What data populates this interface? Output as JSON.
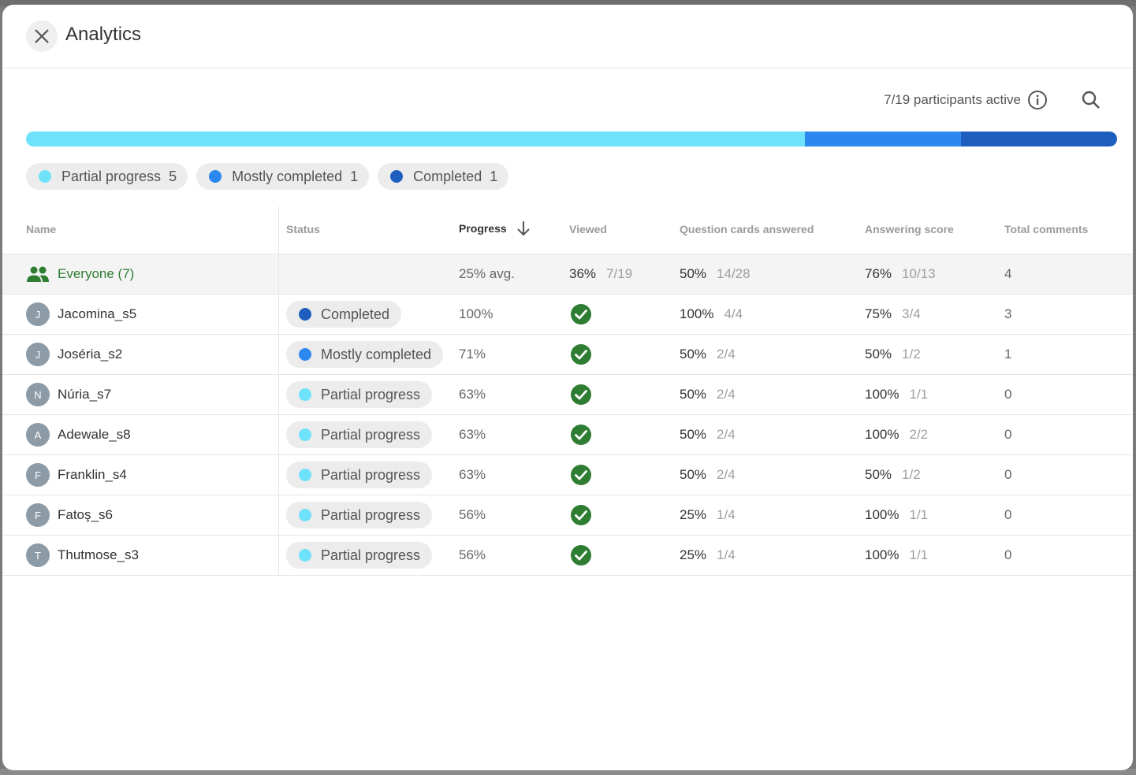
{
  "dialog": {
    "title": "Analytics",
    "close_icon": "close-icon"
  },
  "summary": {
    "active_text": "7/19 participants active",
    "info_icon": "info-icon",
    "search_icon": "search-icon"
  },
  "progress_bar": {
    "partial_fraction": 0.714,
    "mostly_fraction": 0.143,
    "completed_fraction": 0.143
  },
  "legend": [
    {
      "label": "Partial progress",
      "count": "5",
      "color": "#6fe2fb"
    },
    {
      "label": "Mostly completed",
      "count": "1",
      "color": "#2a88ee"
    },
    {
      "label": "Completed",
      "count": "1",
      "color": "#1e5ebe"
    }
  ],
  "columns": {
    "name": "Name",
    "status": "Status",
    "progress": "Progress",
    "viewed": "Viewed",
    "question_cards": "Question cards answered",
    "answering_score": "Answering score",
    "total_comments": "Total comments",
    "sort_icon": "arrow-down-icon"
  },
  "everyone": {
    "label": "Everyone (7)",
    "icon": "group-icon",
    "progress": "25% avg.",
    "viewed_pct": "36%",
    "viewed_frac": "7/19",
    "cards_pct": "50%",
    "cards_frac": "14/28",
    "score_pct": "76%",
    "score_frac": "10/13",
    "comments": "4"
  },
  "rows": [
    {
      "initial": "J",
      "name": "Jacomina_s5",
      "status": "Completed",
      "status_color": "#1e5ebe",
      "progress": "100%",
      "cards_pct": "100%",
      "cards_frac": "4/4",
      "score_pct": "75%",
      "score_frac": "3/4",
      "comments": "3"
    },
    {
      "initial": "J",
      "name": "Joséria_s2",
      "status": "Mostly completed",
      "status_color": "#2a88ee",
      "progress": "71%",
      "cards_pct": "50%",
      "cards_frac": "2/4",
      "score_pct": "50%",
      "score_frac": "1/2",
      "comments": "1"
    },
    {
      "initial": "N",
      "name": "Núria_s7",
      "status": "Partial progress",
      "status_color": "#6fe2fb",
      "progress": "63%",
      "cards_pct": "50%",
      "cards_frac": "2/4",
      "score_pct": "100%",
      "score_frac": "1/1",
      "comments": "0"
    },
    {
      "initial": "A",
      "name": "Adewale_s8",
      "status": "Partial progress",
      "status_color": "#6fe2fb",
      "progress": "63%",
      "cards_pct": "50%",
      "cards_frac": "2/4",
      "score_pct": "100%",
      "score_frac": "2/2",
      "comments": "0"
    },
    {
      "initial": "F",
      "name": "Franklin_s4",
      "status": "Partial progress",
      "status_color": "#6fe2fb",
      "progress": "63%",
      "cards_pct": "50%",
      "cards_frac": "2/4",
      "score_pct": "50%",
      "score_frac": "1/2",
      "comments": "0"
    },
    {
      "initial": "F",
      "name": "Fatoş_s6",
      "status": "Partial progress",
      "status_color": "#6fe2fb",
      "progress": "56%",
      "cards_pct": "25%",
      "cards_frac": "1/4",
      "score_pct": "100%",
      "score_frac": "1/1",
      "comments": "0"
    },
    {
      "initial": "T",
      "name": "Thutmose_s3",
      "status": "Partial progress",
      "status_color": "#6fe2fb",
      "progress": "56%",
      "cards_pct": "25%",
      "cards_frac": "1/4",
      "score_pct": "100%",
      "score_frac": "1/1",
      "comments": "0"
    }
  ],
  "viewed_icon": "check-circle-icon",
  "colors": {
    "accent_green": "#2e7d32",
    "check_green": "#2e7d32"
  }
}
